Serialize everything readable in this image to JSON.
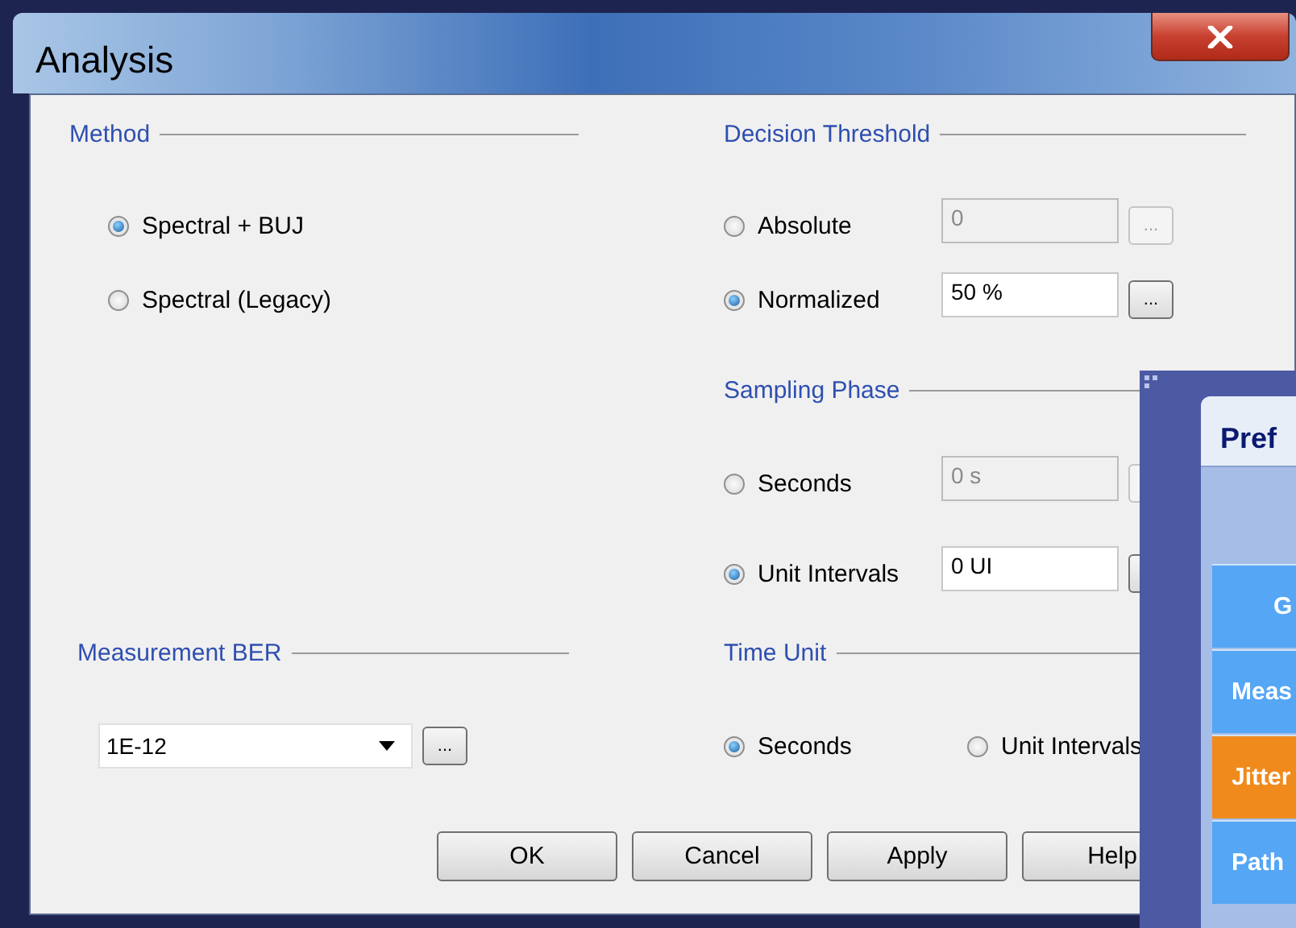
{
  "window": {
    "title": "Analysis"
  },
  "method": {
    "label": "Method",
    "options": [
      {
        "label": "Spectral + BUJ",
        "selected": true
      },
      {
        "label": "Spectral (Legacy)",
        "selected": false
      }
    ]
  },
  "decision_threshold": {
    "label": "Decision Threshold",
    "options": [
      {
        "label": "Absolute",
        "selected": false,
        "value": "0",
        "disabled": true,
        "button": "..."
      },
      {
        "label": "Normalized",
        "selected": true,
        "value": "50 %",
        "disabled": false,
        "button": "..."
      }
    ]
  },
  "sampling_phase": {
    "label": "Sampling Phase",
    "options": [
      {
        "label": "Seconds",
        "selected": false,
        "value": "0 s",
        "disabled": true
      },
      {
        "label": "Unit Intervals",
        "selected": true,
        "value": "0 UI",
        "disabled": false
      }
    ]
  },
  "measurement_ber": {
    "label": "Measurement BER",
    "value": "1E-12",
    "button": "..."
  },
  "time_unit": {
    "label": "Time Unit",
    "options": [
      {
        "label": "Seconds",
        "selected": true
      },
      {
        "label": "Unit Intervals",
        "selected": false
      }
    ]
  },
  "buttons": [
    "OK",
    "Cancel",
    "Apply",
    "Help"
  ],
  "preferences_window": {
    "title": "Pref",
    "items": [
      {
        "label": "G",
        "selected": false
      },
      {
        "label": "Meas",
        "selected": false
      },
      {
        "label": "Jitter",
        "selected": true
      },
      {
        "label": "Path",
        "selected": false
      }
    ]
  }
}
